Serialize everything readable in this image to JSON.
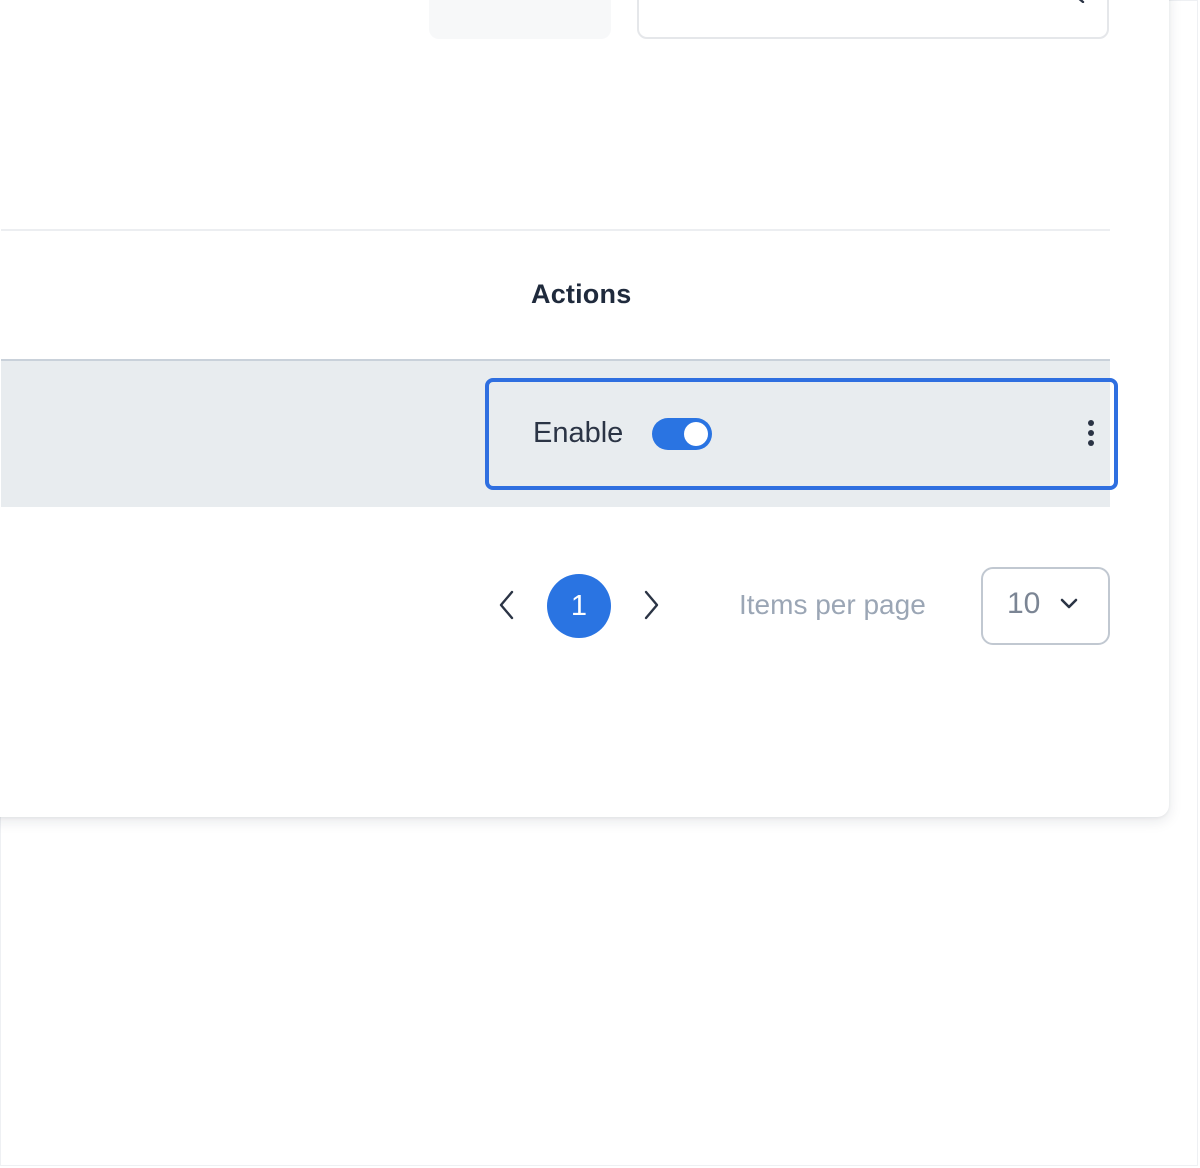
{
  "table": {
    "header": {
      "actions_label": "Actions"
    },
    "row": {
      "toggle_label": "Enable",
      "toggle_state": "on"
    }
  },
  "pagination": {
    "current_page": "1",
    "items_per_page_label": "Items per page",
    "items_per_page_value": "10"
  },
  "colors": {
    "accent": "#2a74e2",
    "focus_ring": "#2f6fe0",
    "row_background": "#e8ecef"
  }
}
